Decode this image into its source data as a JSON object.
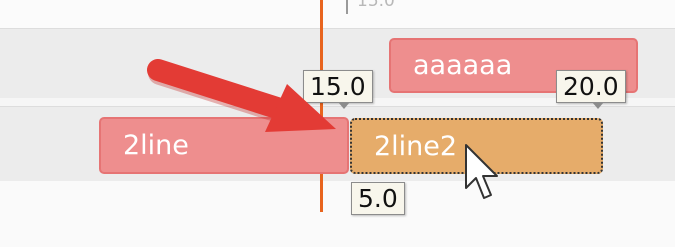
{
  "ruler": {
    "label": "15.0"
  },
  "tracks": {
    "top": {
      "clip_label": "aaaaaa"
    },
    "bottom": {
      "left_clip_label": "2line",
      "selected_clip_label": "2line2"
    }
  },
  "tooltips": {
    "start": "15.0",
    "end": "20.0",
    "duration": "5.0"
  },
  "colors": {
    "clip": "#ee8e8e",
    "selected_clip": "#e6ac6a",
    "playhead": "#e8641e",
    "annotation_arrow": "#e33b35"
  },
  "icons": {
    "cursor": "mouse-pointer-icon",
    "callout": "arrow-annotation-icon"
  }
}
